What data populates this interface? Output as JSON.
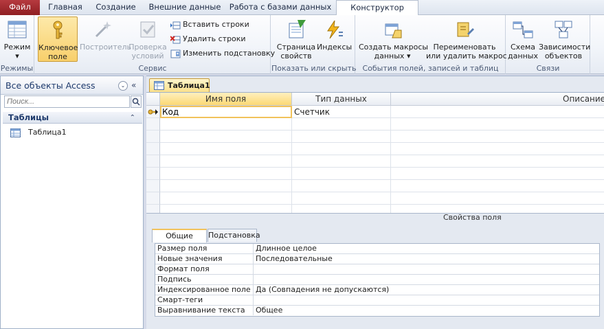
{
  "tabs": {
    "file": "Файл",
    "home": "Главная",
    "create": "Создание",
    "external": "Внешние данные",
    "dbtools": "Работа с базами данных",
    "design": "Конструктор"
  },
  "ribbon": {
    "views": {
      "label": "Режимы",
      "view_line1": "Режим",
      "view_arrow": "▾"
    },
    "tools": {
      "label": "Сервис",
      "primary_key_line1": "Ключевое",
      "primary_key_line2": "поле",
      "builder": "Построитель",
      "test_rules_line1": "Проверка",
      "test_rules_line2": "условий",
      "insert_rows": "Вставить строки",
      "delete_rows": "Удалить строки",
      "modify_lookups": "Изменить подстановку"
    },
    "show_hide": {
      "label": "Показать или скрыть",
      "property_sheet_line1": "Страница",
      "property_sheet_line2": "свойств",
      "indexes": "Индексы"
    },
    "events": {
      "label": "События полей, записей и таблиц",
      "create_macros_line1": "Создать макросы",
      "create_macros_line2": "данных",
      "create_macros_arrow": "▾",
      "rename_macro_line1": "Переименовать",
      "rename_macro_line2": "или удалить макрос"
    },
    "relationships": {
      "label": "Связи",
      "relationships_line1": "Схема",
      "relationships_line2": "данных",
      "dependencies_line1": "Зависимости",
      "dependencies_line2": "объектов"
    }
  },
  "nav": {
    "title": "Все объекты Access",
    "dropdown_glyph": "⌄",
    "collapse_glyph": "«",
    "search_placeholder": "Поиск...",
    "section": "Таблицы",
    "section_collapse_glyph": "⌃",
    "items": [
      {
        "label": "Таблица1"
      }
    ]
  },
  "document": {
    "tab": "Таблица1",
    "columns": {
      "name": "Имя поля",
      "type": "Тип данных",
      "description": "Описание"
    },
    "rows": [
      {
        "name": "Код",
        "type": "Счетчик",
        "description": ""
      }
    ],
    "colors": {
      "selection": "#fbd874",
      "accent": "#f1c25a"
    }
  },
  "properties": {
    "title": "Свойства поля",
    "tabs": {
      "general": "Общие",
      "lookup": "Подстановка"
    },
    "rows": [
      {
        "name": "Размер поля",
        "value": "Длинное целое"
      },
      {
        "name": "Новые значения",
        "value": "Последовательные"
      },
      {
        "name": "Формат поля",
        "value": ""
      },
      {
        "name": "Подпись",
        "value": ""
      },
      {
        "name": "Индексированное поле",
        "value": "Да (Совпадения не допускаются)"
      },
      {
        "name": "Смарт-теги",
        "value": ""
      },
      {
        "name": "Выравнивание текста",
        "value": "Общее"
      }
    ]
  }
}
